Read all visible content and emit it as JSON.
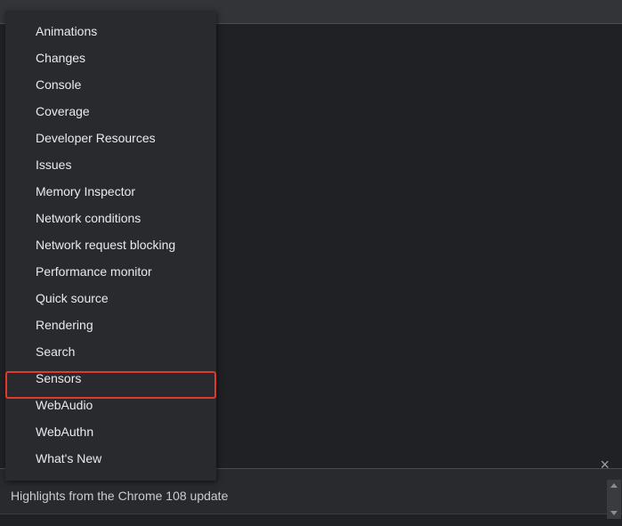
{
  "menu": {
    "items": [
      "Animations",
      "Changes",
      "Console",
      "Coverage",
      "Developer Resources",
      "Issues",
      "Memory Inspector",
      "Network conditions",
      "Network request blocking",
      "Performance monitor",
      "Quick source",
      "Rendering",
      "Search",
      "Sensors",
      "WebAudio",
      "WebAuthn",
      "What's New"
    ],
    "highlighted_index": 13
  },
  "drawer": {
    "highlight_text": "Highlights from the Chrome 108 update",
    "close_glyph": "×"
  }
}
